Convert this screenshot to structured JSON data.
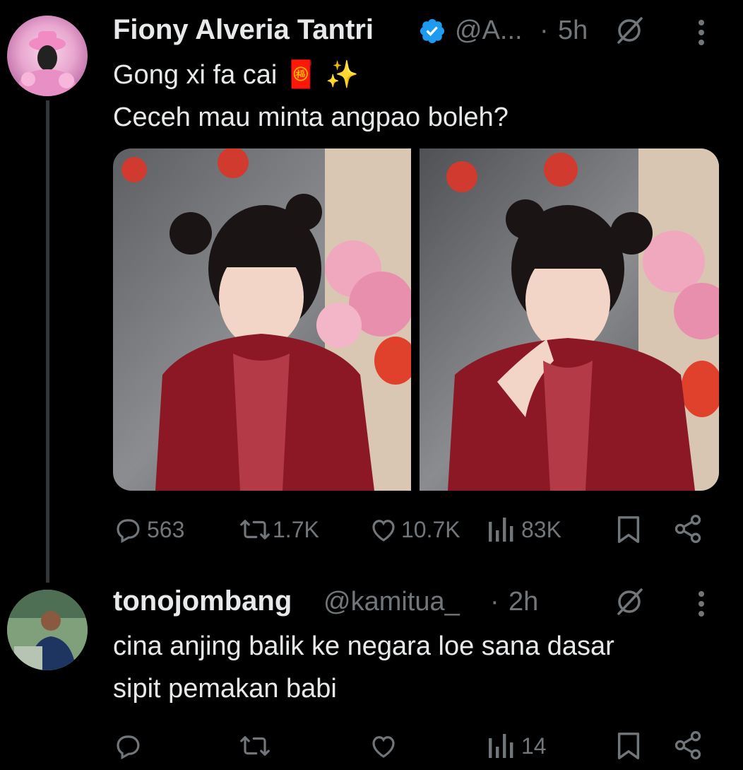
{
  "tweet": {
    "author_name": "Fiony Alveria Tantri",
    "handle": "@A...",
    "separator": "·",
    "time": "5h",
    "line1": "Gong xi fa cai",
    "line1_emojis": "🧧 ✨",
    "line2": "Ceceh mau minta angpao boleh?",
    "stats": {
      "replies": "563",
      "retweets": "1.7K",
      "likes": "10.7K",
      "views": "83K"
    }
  },
  "reply": {
    "author_name": "tonojombang",
    "handle": "@kamitua_",
    "separator": "·",
    "time": "2h",
    "line1": "cina anjing balik ke negara loe sana dasar",
    "line2": "sipit pemakan babi",
    "stats": {
      "views": "14"
    }
  },
  "colors": {
    "background": "#000000",
    "text": "#e7e9ea",
    "muted": "#71767b",
    "verified": "#1d9bf0",
    "line": "#333639"
  },
  "icons": {
    "verified": "verified-badge-icon",
    "grok": "grok-icon",
    "more": "more-icon",
    "reply": "reply-icon",
    "retweet": "retweet-icon",
    "like": "like-icon",
    "views": "views-icon",
    "bookmark": "bookmark-icon",
    "share": "share-icon"
  }
}
